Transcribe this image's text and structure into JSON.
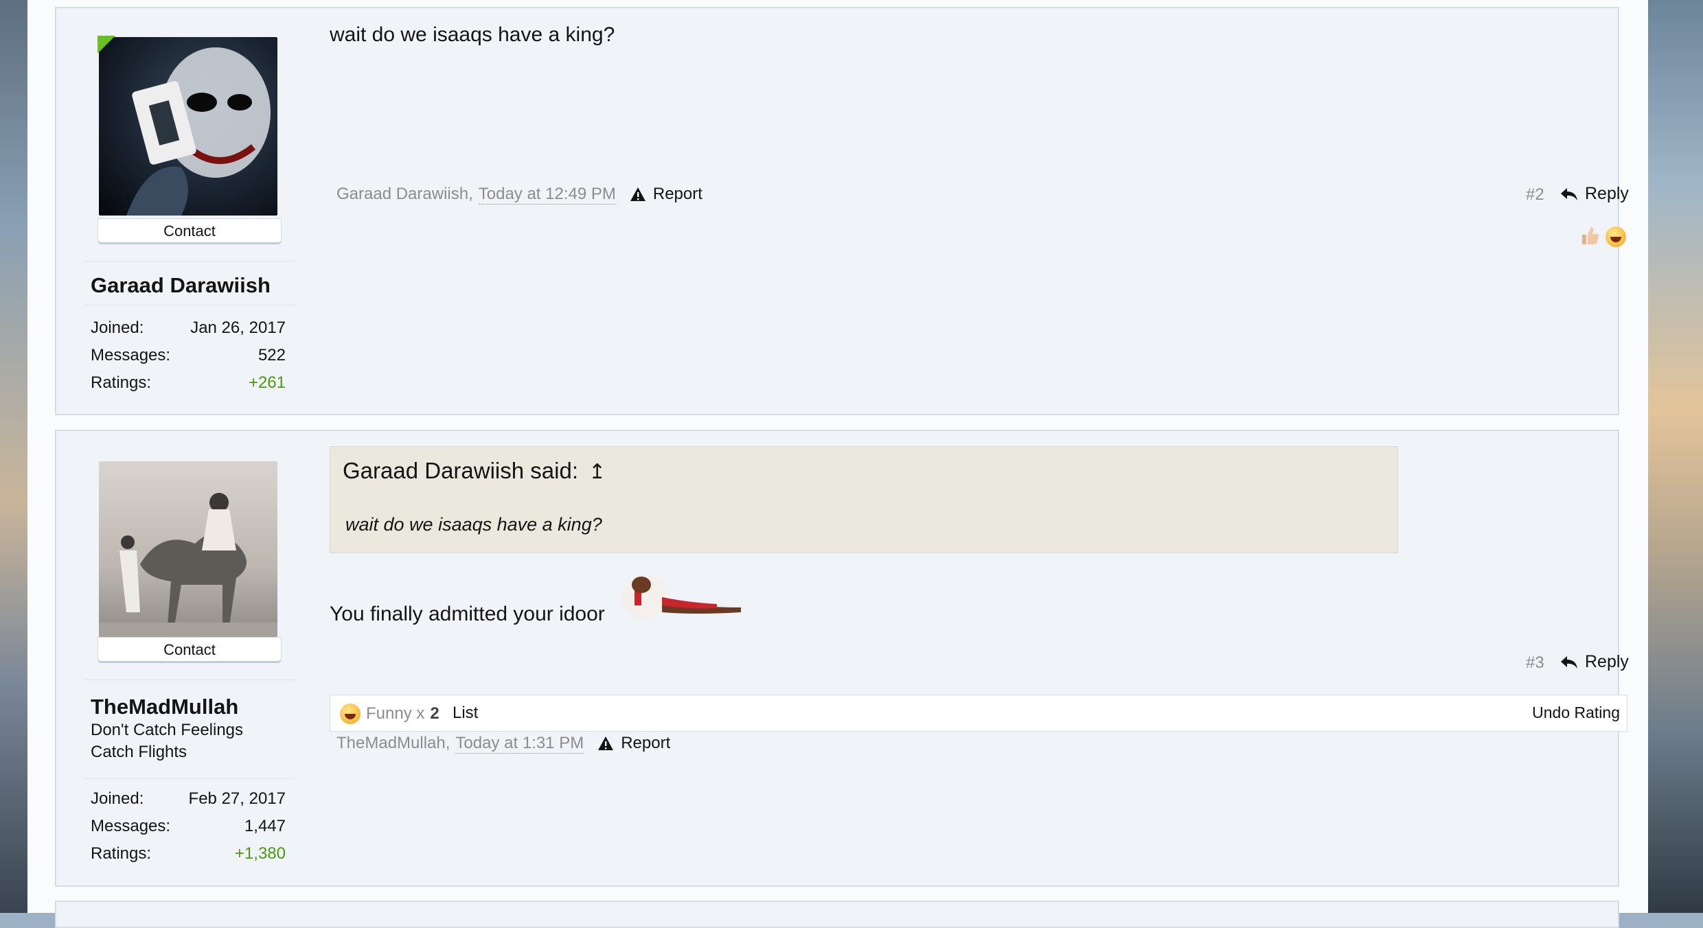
{
  "posts": [
    {
      "message": "wait do we isaaqs have a king?",
      "author": "Garaad Darawiish,",
      "time": "Today at 12:49 PM",
      "report": "Report",
      "post_number": "#2",
      "reply": "Reply",
      "user": {
        "contact": "Contact",
        "name": "Garaad Darawiish",
        "stats": [
          {
            "label": "Joined:",
            "value": "Jan 26, 2017"
          },
          {
            "label": "Messages:",
            "value": "522"
          },
          {
            "label": "Ratings:",
            "value": "+261"
          }
        ]
      }
    },
    {
      "quote_attribution": "Garaad Darawiish said:",
      "quote_arrow": "↥",
      "quote_text": "wait do we isaaqs have a king?",
      "message": "You finally admitted your idoor",
      "author": "TheMadMullah,",
      "time": "Today at 1:31 PM",
      "report": "Report",
      "post_number": "#3",
      "reply": "Reply",
      "user": {
        "contact": "Contact",
        "name": "TheMadMullah",
        "title_line1": "Don't Catch Feelings",
        "title_line2": "Catch Flights",
        "stats": [
          {
            "label": "Joined:",
            "value": "Feb 27, 2017"
          },
          {
            "label": "Messages:",
            "value": "1,447"
          },
          {
            "label": "Ratings:",
            "value": "+1,380"
          }
        ]
      },
      "ratings": {
        "funny_label": "Funny x",
        "funny_count": "2",
        "list": "List",
        "undo": "Undo Rating"
      }
    }
  ],
  "colors": {
    "ratings_positive": "#4a9a12",
    "online_indicator": "#6bbf1e",
    "quote_bg": "#ebe9de"
  }
}
